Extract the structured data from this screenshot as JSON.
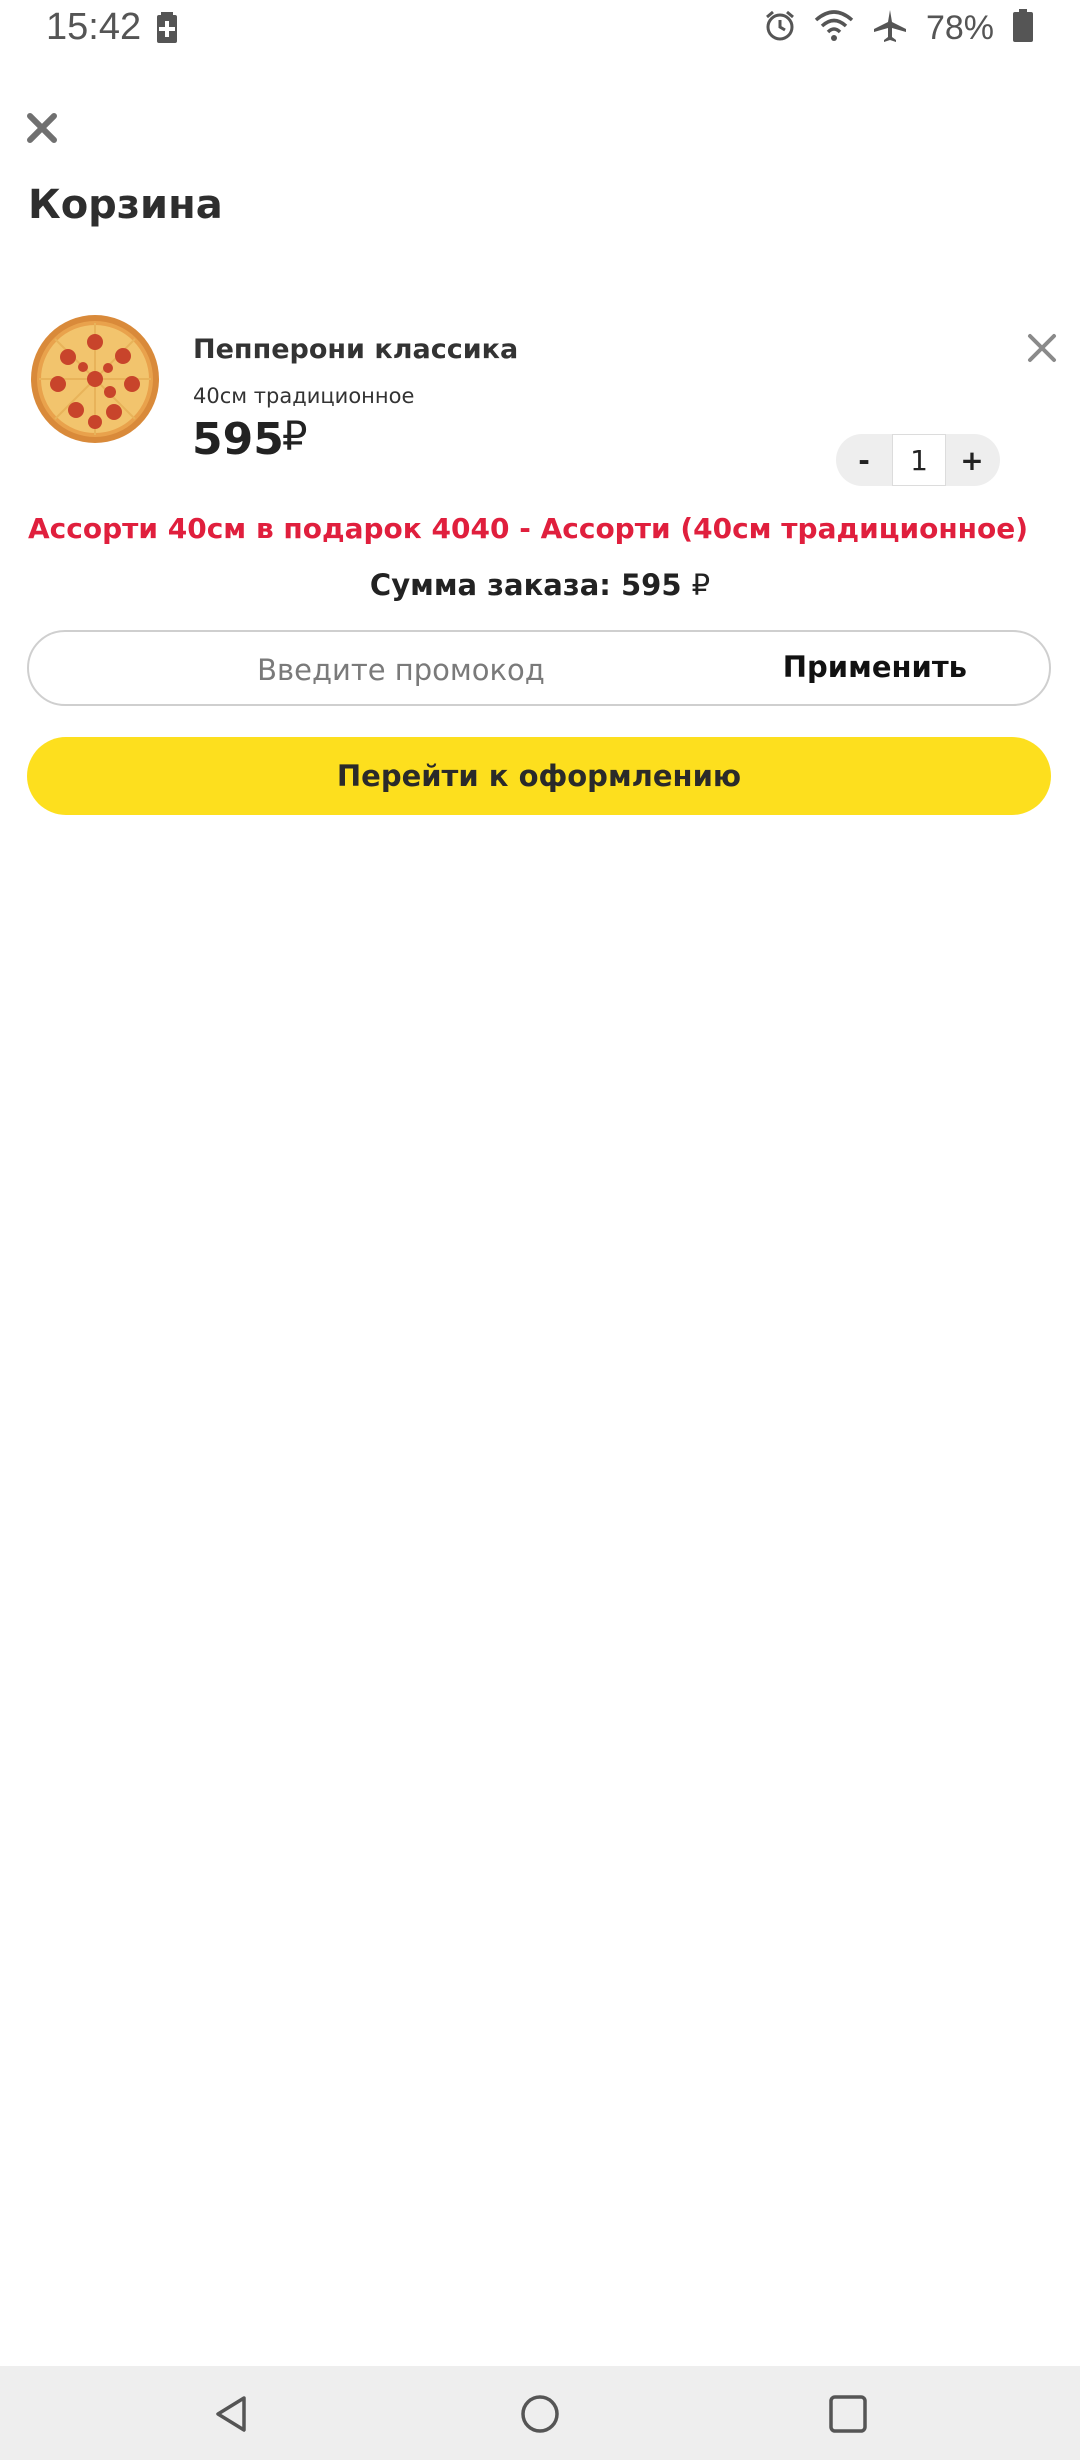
{
  "status_bar": {
    "time": "15:42",
    "battery_percent": "78%",
    "icons": [
      "battery-saver-icon",
      "alarm-icon",
      "wifi-icon",
      "airplane-icon",
      "battery-icon"
    ]
  },
  "header": {
    "title": "Корзина",
    "close_icon": "close-icon"
  },
  "cart": {
    "items": [
      {
        "name": "Пепперони классика",
        "variant": "40см традиционное",
        "price": "595",
        "currency": "₽",
        "quantity": "1",
        "minus_label": "-",
        "plus_label": "+",
        "image": "pepperoni-pizza-image"
      }
    ],
    "gift_text": "Ассорти 40см в подарок 4040 - Ассорти (40см традиционное)",
    "total_label": "Сумма заказа: 595",
    "total_currency": "₽"
  },
  "promo": {
    "placeholder": "Введите промокод",
    "apply_label": "Применить"
  },
  "checkout": {
    "label": "Перейти к оформлению"
  },
  "colors": {
    "accent_yellow": "#fddf1e",
    "promo_red": "#e01f3d",
    "text_dark": "#2b2b2b"
  },
  "nav_bar": {
    "icons": [
      "back-icon",
      "home-icon",
      "recent-apps-icon"
    ]
  }
}
